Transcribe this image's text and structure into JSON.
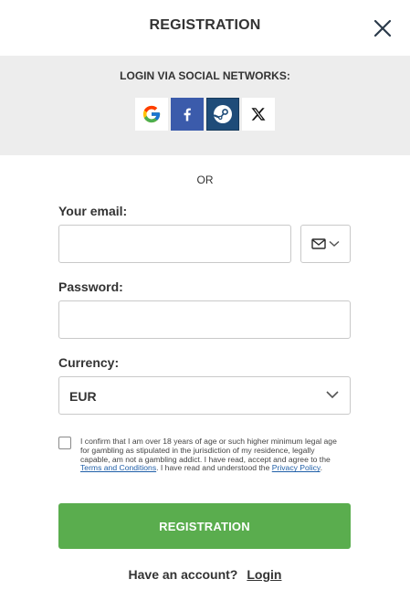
{
  "header": {
    "title": "REGISTRATION"
  },
  "social": {
    "title": "LOGIN VIA SOCIAL NETWORKS:",
    "providers": [
      "google-icon",
      "facebook-icon",
      "steam-icon",
      "x-icon"
    ],
    "colors": {
      "facebook": "#3b5bab",
      "steam": "#1f4c79",
      "panel_bg": "#ededed"
    }
  },
  "divider": {
    "or": "OR"
  },
  "form": {
    "email_label": "Your email:",
    "email_value": "",
    "contact_type_icon": "mail-icon",
    "password_label": "Password:",
    "password_value": "",
    "currency_label": "Currency:",
    "currency_value": "EUR",
    "terms": {
      "checked": false,
      "text_before": "I confirm that I am over 18 years of age or such higher minimum legal age for gambling as stipulated in the jurisdiction of my residence, legally capable, am not a gambling addict. I have read, accept and agree to the ",
      "terms_link": "Terms and Conditions",
      "text_middle": ". I have read and understood the ",
      "privacy_link": "Privacy Policy",
      "text_after": "."
    },
    "submit_label": "REGISTRATION",
    "accent_color": "#5aad4e"
  },
  "footer": {
    "prompt": "Have an account?",
    "login_link": "Login"
  }
}
